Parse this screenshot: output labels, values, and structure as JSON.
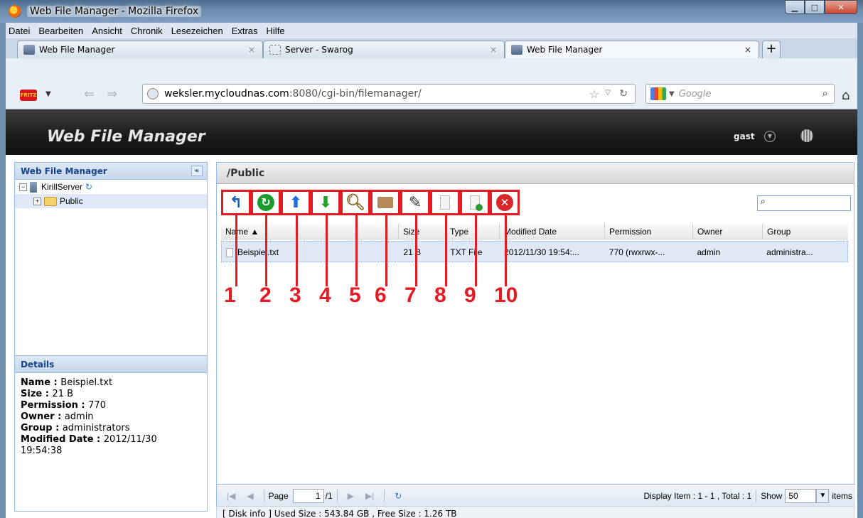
{
  "window": {
    "title": "Web File Manager - Mozilla Firefox"
  },
  "menu": [
    "Datei",
    "Bearbeiten",
    "Ansicht",
    "Chronik",
    "Lesezeichen",
    "Extras",
    "Hilfe"
  ],
  "tabs": [
    {
      "label": "Web File Manager"
    },
    {
      "label": "Server - Swarog"
    },
    {
      "label": "Web File Manager"
    }
  ],
  "nav": {
    "url_host": "weksler.mycloudnas.com",
    "url_prefix": "",
    "url_suffix": ":8080/cgi-bin/filemanager/",
    "search_placeholder": "Google"
  },
  "app": {
    "title": "Web File Manager",
    "user": "gast",
    "left_panel_title": "Web File Manager",
    "tree": {
      "server": "KirillServer",
      "folder": "Public"
    },
    "details_title": "Details",
    "details": [
      {
        "key": "Name",
        "value": "Beispiel.txt"
      },
      {
        "key": "Size",
        "value": "21 B"
      },
      {
        "key": "Permission",
        "value": "770"
      },
      {
        "key": "Owner",
        "value": "admin"
      },
      {
        "key": "Group",
        "value": "administrators"
      },
      {
        "key": "Modified Date",
        "value": "2012/11/30 19:54:38"
      }
    ],
    "path": "/Public",
    "columns": [
      "Name",
      "Size",
      "Type",
      "Modified Date",
      "Permission",
      "Owner",
      "Group"
    ],
    "row": {
      "name": "Beispiel.txt",
      "size": "21 B",
      "type": "TXT File",
      "modified": "2012/11/30 19:54:...",
      "permission": "770 (rwxrwx-...",
      "owner": "admin",
      "group": "administra..."
    },
    "callouts": [
      "1",
      "2",
      "3",
      "4",
      "5",
      "6",
      "7",
      "8",
      "9",
      "10"
    ],
    "pager": {
      "page_label": "Page",
      "page_value": "1",
      "page_total": "/1",
      "display": "Display Item : 1 - 1 , Total : 1",
      "show_label": "Show",
      "show_value": "50",
      "items_label": "items"
    },
    "status": "[ Disk info ] Used Size : 543.84 GB , Free Size : 1.26 TB"
  }
}
